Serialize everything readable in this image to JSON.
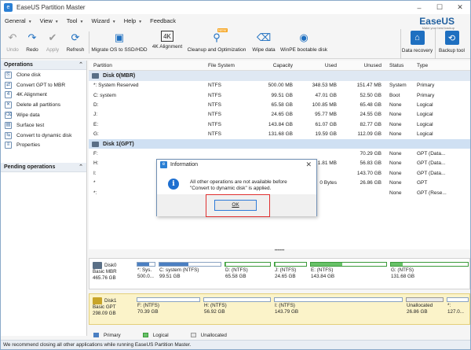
{
  "window": {
    "title": "EaseUS Partition Master",
    "controls": [
      "–",
      "☐",
      "✕"
    ]
  },
  "menu": [
    {
      "label": "General",
      "dropdown": true
    },
    {
      "label": "View",
      "dropdown": true
    },
    {
      "label": "Tool",
      "dropdown": true
    },
    {
      "label": "Wizard",
      "dropdown": true
    },
    {
      "label": "Help",
      "dropdown": true
    },
    {
      "label": "Feedback",
      "dropdown": false
    }
  ],
  "logo": {
    "text": "EaseUS",
    "tagline": "Make your best backup"
  },
  "toolbar": {
    "undo": "Undo",
    "redo": "Redo",
    "apply": "Apply",
    "refresh": "Refresh",
    "migrate": "Migrate OS to SSD/HDD",
    "alignment": "4K Alignment",
    "cleanup": "Cleanup and Optimization",
    "new_badge": "NEW",
    "wipe": "Wipe data",
    "winpe": "WinPE bootable disk",
    "data_recovery": "Data recovery",
    "backup_tool": "Backup tool",
    "alignment_icon_text": "4K"
  },
  "operations": {
    "title": "Operations",
    "items": [
      "Clone disk",
      "Convert GPT to MBR",
      "4K Alignment",
      "Delete all partitions",
      "Wipe data",
      "Surface test",
      "Convert to dynamic disk",
      "Properties"
    ]
  },
  "pending": {
    "title": "Pending operations"
  },
  "table": {
    "headers": [
      "Partition",
      "File System",
      "Capacity",
      "Used",
      "Unused",
      "Status",
      "Type"
    ],
    "disk0": "Disk 0(MBR)",
    "disk0_rows": [
      [
        "*: System Reserved",
        "NTFS",
        "500.00 MB",
        "348.53 MB",
        "151.47 MB",
        "System",
        "Primary"
      ],
      [
        "C: system",
        "NTFS",
        "99.51 GB",
        "47.01 GB",
        "52.50 GB",
        "Boot",
        "Primary"
      ],
      [
        "D:",
        "NTFS",
        "65.58 GB",
        "100.85 MB",
        "65.48 GB",
        "None",
        "Logical"
      ],
      [
        "J:",
        "NTFS",
        "24.65 GB",
        "95.77 MB",
        "24.55 GB",
        "None",
        "Logical"
      ],
      [
        "E:",
        "NTFS",
        "143.84 GB",
        "61.07 GB",
        "82.77 GB",
        "None",
        "Logical"
      ],
      [
        "G:",
        "NTFS",
        "131.68 GB",
        "19.59 GB",
        "112.09 GB",
        "None",
        "Logical"
      ]
    ],
    "disk1": "Disk 1(GPT)",
    "disk1_rows": [
      [
        "F:",
        "",
        "",
        "",
        "70.29 GB",
        "None",
        "GPT (Data..."
      ],
      [
        "H:",
        "",
        "",
        "1.81 MB",
        "56.83 GB",
        "None",
        "GPT (Data..."
      ],
      [
        "I:",
        "",
        "",
        "",
        "143.70 GB",
        "None",
        "GPT (Data..."
      ],
      [
        "*",
        "",
        "",
        "0 Bytes",
        "26.86 GB",
        "None",
        "GPT"
      ],
      [
        "*:",
        "",
        "",
        "",
        "",
        "None",
        "GPT (Rese..."
      ]
    ]
  },
  "diskmap": {
    "disk0": {
      "name": "Disk0",
      "kind": "Basic MBR",
      "size": "465.76 GB"
    },
    "disk0_parts": [
      {
        "name": "*: Sys.",
        "size": "500.0...",
        "type": "primary",
        "used_fraction": 0.7
      },
      {
        "name": "C: system (NTFS)",
        "size": "99.51 GB",
        "type": "primary",
        "used_fraction": 0.47
      },
      {
        "name": "D: (NTFS)",
        "size": "65.58 GB",
        "type": "logical",
        "used_fraction": 0.02
      },
      {
        "name": "J: (NTFS)",
        "size": "24.65 GB",
        "type": "logical",
        "used_fraction": 0.02
      },
      {
        "name": "E: (NTFS)",
        "size": "143.84 GB",
        "type": "logical",
        "used_fraction": 0.42
      },
      {
        "name": "G: (NTFS)",
        "size": "131.68 GB",
        "type": "logical",
        "used_fraction": 0.15
      }
    ],
    "disk1": {
      "name": "Disk1",
      "kind": "Basic GPT",
      "size": "298.09 GB"
    },
    "disk1_parts": [
      {
        "name": "F: (NTFS)",
        "size": "70.39 GB",
        "type": "primary",
        "used_fraction": 0.0
      },
      {
        "name": "H: (NTFS)",
        "size": "56.92 GB",
        "type": "primary",
        "used_fraction": 0.0
      },
      {
        "name": "I: (NTFS)",
        "size": "143.79 GB",
        "type": "primary",
        "used_fraction": 0.0
      },
      {
        "name": "Unallocated",
        "size": "26.86 GB",
        "type": "unalloc",
        "used_fraction": 0.0
      },
      {
        "name": "*:",
        "size": "127.0...",
        "type": "primary",
        "used_fraction": 0.0
      }
    ]
  },
  "legend": [
    "Primary",
    "Logical",
    "Unallocated"
  ],
  "status": "We recommend closing all other applications while running EaseUS Partition Master.",
  "dialog": {
    "title": "Information",
    "message": "All other operations are not available before \"Convert to dynamic disk\" is applied.",
    "ok": "OK"
  }
}
